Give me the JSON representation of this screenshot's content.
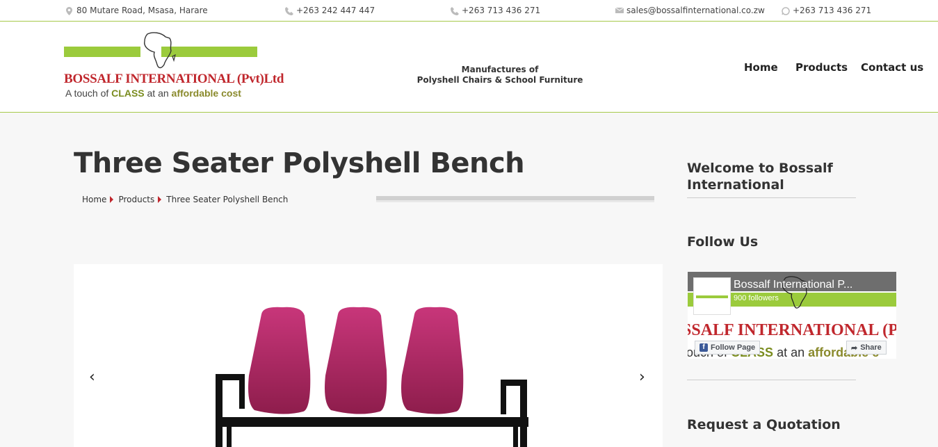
{
  "topbar": {
    "address": "80 Mutare Road, Msasa, Harare",
    "phone1": "+263 242 447 447",
    "phone2": "+263 713 436 271",
    "email": "sales@bossalfinternational.co.zw",
    "whatsapp": "+263 713 436 271"
  },
  "logo": {
    "name": "BOSSALF INTERNATIONAL (Pvt)Ltd",
    "tag_pre": "A touch of ",
    "tag_class": "CLASS",
    "tag_mid": " at an ",
    "tag_aff": "affordable cost"
  },
  "header": {
    "tagline_1": "Manufactures of",
    "tagline_2": "Polyshell Chairs & School Furniture"
  },
  "nav": {
    "home": "Home",
    "products": "Products",
    "contact": "Contact us"
  },
  "main": {
    "title": "Three Seater Polyshell Bench",
    "breadcrumb": [
      "Home",
      "Products",
      "Three Seater Polyshell Bench"
    ]
  },
  "sidebar": {
    "welcome": "Welcome to Bossalf International",
    "follow": "Follow Us",
    "quote": "Request a Quotation",
    "fb": {
      "page_name": "Bossalf International P...",
      "followers": "900 followers",
      "follow_btn": "Follow Page",
      "share_btn": "Share",
      "banner_name": "SSALF INTERNATIONAL (Pvt)L",
      "banner_tag_pre": "ouch of ",
      "banner_tag_class": "CLASS",
      "banner_tag_mid": " at an ",
      "banner_tag_aff": "affordable c"
    }
  },
  "colors": {
    "brand_green": "#9bcb3c",
    "brand_red": "#c0272d",
    "seat_magenta": "#b0245f"
  }
}
